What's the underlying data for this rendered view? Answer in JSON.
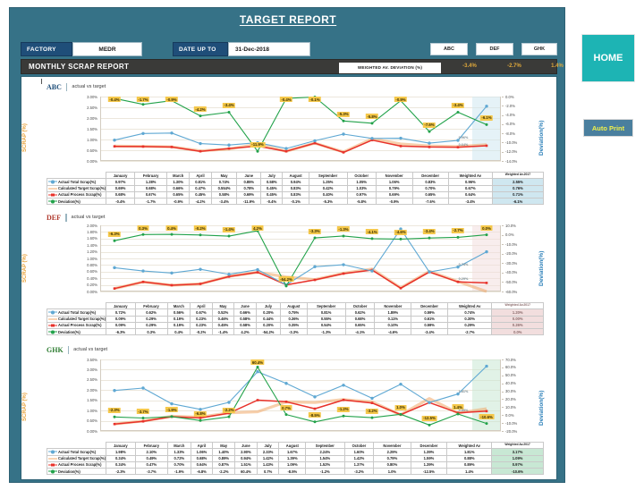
{
  "header": {
    "title": "TARGET REPORT",
    "factory_label": "FACTORY",
    "factory_value": "MEDR",
    "date_label": "DATE UP TO",
    "date_value": "31-Dec-2018",
    "nav": [
      {
        "label": "ABC"
      },
      {
        "label": "DEF"
      },
      {
        "label": "GHK"
      }
    ]
  },
  "band": {
    "title": "MONTHLY SCRAP REPORT",
    "wad_label": "WEIGHTED AV. DEVIATION (%)",
    "wad_values": [
      "-3.4%",
      "-2.7%",
      "1.4%"
    ]
  },
  "side": {
    "home_label": "HOME",
    "autoprint_label": "Auto Print"
  },
  "common": {
    "subtitle": "actual vs target",
    "ylabel_left": "SCRAP (%)",
    "ylabel_right": "Deviation(%)",
    "months": [
      "January",
      "February",
      "March",
      "April",
      "May",
      "June",
      "July",
      "August",
      "September",
      "October",
      "November",
      "December"
    ],
    "col_weighted": "Weighted Av",
    "col_weighted_2017": "Weighted Av.2017",
    "series_names": [
      "Actual Total Scrap(%)",
      "Calculated Target Scrap(%)",
      "Actual Process Scrap(%)",
      "Deviation(%)"
    ],
    "colors": {
      "total": "#5fa8d3",
      "target": "#f0a868",
      "process": "#e8312a",
      "deviation": "#22a24a",
      "label_bg": "#f5c84b",
      "accent_teal": "#1db4b4",
      "header_blue": "#367287",
      "band_dark": "#3a3a38",
      "wad_gold": "#e0a93b"
    }
  },
  "chart_data": [
    {
      "type": "line",
      "id": "ABC",
      "code": "ABC",
      "code_color": "#1f4e79",
      "title": "ABC actual vs target",
      "xlabel": "",
      "ylabel": "SCRAP (%)",
      "ylabel_right": "Deviation(%)",
      "categories": [
        "January",
        "February",
        "March",
        "April",
        "May",
        "June",
        "July",
        "August",
        "September",
        "October",
        "November",
        "December",
        "Weighted Av",
        "Weighted Av.2017"
      ],
      "ylim": [
        0,
        3.0
      ],
      "yticks": [
        "0.00%",
        "0.50%",
        "1.00%",
        "1.50%",
        "2.00%",
        "2.50%",
        "3.00%"
      ],
      "ylim_right": [
        -14.0,
        0.0
      ],
      "yticks_right": [
        "0.0%",
        "-2.0%",
        "-4.0%",
        "-6.0%",
        "-8.0%",
        "-10.0%",
        "-12.0%",
        "-14.0%"
      ],
      "grid": true,
      "highlight_column": "Weighted Av.2017",
      "series": [
        {
          "name": "Actual Total Scrap(%)",
          "color": "#5fa8d3",
          "axis": "left",
          "values": [
            0.97,
            1.28,
            1.3,
            0.81,
            0.74,
            0.85,
            0.58,
            0.94,
            1.25,
            1.05,
            1.06,
            0.83,
            0.96,
            2.55
          ]
        },
        {
          "name": "Calculated Target Scrap(%)",
          "color": "#f0a868",
          "axis": "left",
          "values": [
            0.69,
            0.68,
            0.66,
            0.47,
            0.554,
            0.78,
            0.45,
            0.83,
            0.42,
            1.03,
            0.79,
            0.7,
            0.67,
            0.76
          ]
        },
        {
          "name": "Actual Process Scrap(%)",
          "color": "#e8312a",
          "axis": "left",
          "values": [
            0.68,
            0.67,
            0.65,
            0.45,
            0.58,
            0.69,
            0.45,
            0.83,
            0.4,
            0.97,
            0.69,
            0.65,
            0.64,
            0.71
          ]
        },
        {
          "name": "Deviation(%)",
          "color": "#22a24a",
          "axis": "right",
          "values": [
            -0.4,
            -1.7,
            -0.9,
            -4.2,
            -3.4,
            -11.9,
            -0.4,
            -0.1,
            -5.3,
            -5.8,
            -0.9,
            -7.6,
            -3.4,
            -6.1
          ]
        }
      ],
      "data_labels": [
        "-0.4%",
        "-1.7%",
        "-0.9%",
        "-4.2%",
        "-3.4%",
        "-11.9%",
        "-0.4%",
        "-0.1%",
        "-5.3%",
        "-5.8%",
        "-0.9%",
        "-7.6%",
        "-3.4%",
        "-6.1%"
      ],
      "extra_labels": [
        {
          "text": "0.96%",
          "after_index": 12
        },
        {
          "text": "0.64%",
          "after_index": 12
        }
      ],
      "table": {
        "columns": [
          "January",
          "February",
          "March",
          "April",
          "May",
          "June",
          "July",
          "August",
          "September",
          "October",
          "November",
          "December",
          "Weighted Av",
          "Weighted Av.2017"
        ],
        "rows": [
          {
            "name": "Actual Total Scrap(%)",
            "values": [
              "0.97%",
              "1.28%",
              "1.30%",
              "0.81%",
              "0.74%",
              "0.85%",
              "0.58%",
              "0.94%",
              "1.25%",
              "1.05%",
              "1.06%",
              "0.83%",
              "0.96%",
              "2.55%"
            ]
          },
          {
            "name": "Calculated Target Scrap(%)",
            "values": [
              "0.69%",
              "0.68%",
              "0.66%",
              "0.47%",
              "0.554%",
              "0.78%",
              "0.45%",
              "0.83%",
              "0.42%",
              "1.03%",
              "0.79%",
              "0.70%",
              "0.67%",
              "0.76%"
            ]
          },
          {
            "name": "Actual Process Scrap(%)",
            "values": [
              "0.68%",
              "0.67%",
              "0.65%",
              "0.45%",
              "0.58%",
              "0.69%",
              "0.45%",
              "0.83%",
              "0.40%",
              "0.97%",
              "0.69%",
              "0.65%",
              "0.64%",
              "0.71%"
            ]
          },
          {
            "name": "Deviation(%)",
            "values": [
              "-0.4%",
              "-1.7%",
              "-0.9%",
              "-4.2%",
              "-3.4%",
              "-11.9%",
              "-0.4%",
              "-0.1%",
              "-5.3%",
              "-5.8%",
              "-0.9%",
              "-7.6%",
              "-3.4%",
              "-6.1%"
            ]
          }
        ]
      }
    },
    {
      "type": "line",
      "id": "DEF",
      "code": "DEF",
      "code_color": "#b03a2e",
      "title": "DEF actual vs target",
      "xlabel": "",
      "ylabel": "SCRAP (%)",
      "ylabel_right": "Deviation(%)",
      "categories": [
        "January",
        "February",
        "March",
        "April",
        "May",
        "June",
        "July",
        "August",
        "September",
        "October",
        "November",
        "December",
        "Weighted Av",
        "Weighted Av.2017"
      ],
      "ylim": [
        0,
        2.0
      ],
      "yticks": [
        "0.00%",
        "0.20%",
        "0.40%",
        "0.60%",
        "0.80%",
        "1.00%",
        "1.20%",
        "1.40%",
        "1.60%",
        "1.80%",
        "2.00%"
      ],
      "ylim_right": [
        -60.0,
        10.0
      ],
      "yticks_right": [
        "10.0%",
        "0.0%",
        "-10.0%",
        "-20.0%",
        "-30.0%",
        "-40.0%",
        "-50.0%",
        "-60.0%"
      ],
      "grid": true,
      "highlight_column": "Weighted Av.2017",
      "series": [
        {
          "name": "Actual Total Scrap(%)",
          "color": "#5fa8d3",
          "axis": "left",
          "values": [
            0.72,
            0.62,
            0.56,
            0.67,
            0.52,
            0.66,
            0.2,
            0.75,
            0.81,
            0.62,
            1.89,
            0.59,
            0.74,
            1.2
          ]
        },
        {
          "name": "Calculated Target Scrap(%)",
          "color": "#f0a868",
          "axis": "left",
          "values": [
            0.09,
            0.29,
            0.19,
            0.23,
            0.46,
            0.58,
            0.44,
            0.36,
            0.55,
            0.68,
            0.11,
            0.61,
            0.3,
            0.0
          ]
        },
        {
          "name": "Actual Process Scrap(%)",
          "color": "#e8312a",
          "axis": "left",
          "values": [
            0.09,
            0.29,
            0.19,
            0.23,
            0.45,
            0.58,
            0.2,
            0.35,
            0.54,
            0.65,
            0.1,
            0.59,
            0.29,
            0.26
          ]
        },
        {
          "name": "Deviation(%)",
          "color": "#22a24a",
          "axis": "right",
          "values": [
            -6.3,
            0.3,
            0.4,
            -0.2,
            -1.4,
            4.2,
            -54.2,
            -3.3,
            -1.3,
            -4.1,
            -4.6,
            -3.4,
            -2.7,
            0.0
          ]
        }
      ],
      "data_labels": [
        "-6.3%",
        "0.3%",
        "0.4%",
        "-0.2%",
        "-1.4%",
        "4.2%",
        "-54.2%",
        "-3.3%",
        "-1.3%",
        "-4.1%",
        "-4.6%",
        "-3.4%",
        "-2.7%",
        "0.0%"
      ],
      "extra_labels": [
        {
          "text": "0.74%",
          "after_index": 12
        },
        {
          "text": "0.29%",
          "after_index": 12
        }
      ],
      "table": {
        "columns": [
          "January",
          "February",
          "March",
          "April",
          "May",
          "June",
          "July",
          "August",
          "September",
          "October",
          "November",
          "December",
          "Weighted Av",
          "Weighted Av.2017"
        ],
        "rows": [
          {
            "name": "Actual Total Scrap(%)",
            "values": [
              "0.72%",
              "0.62%",
              "0.56%",
              "0.67%",
              "0.52%",
              "0.66%",
              "0.20%",
              "0.75%",
              "0.81%",
              "0.62%",
              "1.89%",
              "0.59%",
              "0.74%",
              "1.20%"
            ]
          },
          {
            "name": "Calculated Target Scrap(%)",
            "values": [
              "0.09%",
              "0.29%",
              "0.19%",
              "0.23%",
              "0.46%",
              "0.58%",
              "0.44%",
              "0.36%",
              "0.55%",
              "0.68%",
              "0.11%",
              "0.61%",
              "0.30%",
              "0.00%"
            ]
          },
          {
            "name": "Actual Process Scrap(%)",
            "values": [
              "0.09%",
              "0.29%",
              "0.19%",
              "0.23%",
              "0.45%",
              "0.58%",
              "0.20%",
              "0.35%",
              "0.54%",
              "0.65%",
              "0.10%",
              "0.59%",
              "0.29%",
              "0.26%"
            ]
          },
          {
            "name": "Deviation(%)",
            "values": [
              "-6.3%",
              "0.3%",
              "0.4%",
              "-0.2%",
              "-1.4%",
              "4.2%",
              "-54.2%",
              "-3.3%",
              "-1.3%",
              "-4.1%",
              "-4.6%",
              "-3.4%",
              "-2.7%",
              "0.0%"
            ]
          }
        ]
      }
    },
    {
      "type": "line",
      "id": "GHK",
      "code": "GHK",
      "code_color": "#2e7d32",
      "title": "GHK actual vs target",
      "xlabel": "",
      "ylabel": "SCRAP (%)",
      "ylabel_right": "Deviation(%)",
      "categories": [
        "January",
        "February",
        "March",
        "April",
        "May",
        "June",
        "July",
        "August",
        "September",
        "October",
        "November",
        "December",
        "Weighted Av",
        "Weighted Av.2017"
      ],
      "ylim": [
        0,
        3.5
      ],
      "yticks": [
        "0.00%",
        "0.50%",
        "1.00%",
        "1.50%",
        "2.00%",
        "2.50%",
        "3.00%",
        "3.50%"
      ],
      "ylim_right": [
        -20.0,
        70.0
      ],
      "yticks_right": [
        "70.0%",
        "60.0%",
        "50.0%",
        "40.0%",
        "30.0%",
        "20.0%",
        "10.0%",
        "0.0%",
        "-10.0%",
        "-20.0%"
      ],
      "grid": true,
      "highlight_column": "Weighted Av.2017",
      "series": [
        {
          "name": "Actual Total Scrap(%)",
          "color": "#5fa8d3",
          "axis": "left",
          "values": [
            1.98,
            2.1,
            1.33,
            1.06,
            1.4,
            2.9,
            2.33,
            1.67,
            2.24,
            1.6,
            2.29,
            1.39,
            1.81,
            3.17
          ]
        },
        {
          "name": "Calculated Target Scrap(%)",
          "color": "#f0a868",
          "axis": "left",
          "values": [
            0.34,
            0.49,
            0.72,
            0.68,
            0.89,
            0.94,
            1.42,
            1.39,
            1.54,
            1.42,
            0.79,
            1.59,
            0.88,
            1.09
          ]
        },
        {
          "name": "Actual Process Scrap(%)",
          "color": "#e8312a",
          "axis": "left",
          "values": [
            0.34,
            0.47,
            0.7,
            0.64,
            0.87,
            1.51,
            1.43,
            1.09,
            1.52,
            1.37,
            0.8,
            1.39,
            0.89,
            0.97
          ]
        },
        {
          "name": "Deviation(%)",
          "color": "#22a24a",
          "axis": "right",
          "values": [
            -2.3,
            -3.7,
            -1.9,
            -6.8,
            -2.2,
            60.4,
            0.7,
            -8.5,
            -1.2,
            -3.2,
            1.0,
            -12.5,
            1.4,
            -10.6
          ]
        }
      ],
      "data_labels": [
        "-2.3%",
        "-3.7%",
        "-1.9%",
        "-6.8%",
        "-2.2%",
        "60.4%",
        "0.7%",
        "-8.5%",
        "-1.2%",
        "-3.2%",
        "1.0%",
        "-12.5%",
        "1.4%",
        "-10.6%"
      ],
      "extra_labels": [
        {
          "text": "1.81%",
          "after_index": 12
        },
        {
          "text": "0.89%",
          "after_index": 12
        }
      ],
      "table": {
        "columns": [
          "January",
          "February",
          "March",
          "April",
          "May",
          "June",
          "July",
          "August",
          "September",
          "October",
          "November",
          "December",
          "Weighted Av",
          "Weighted Av.2017"
        ],
        "rows": [
          {
            "name": "Actual Total Scrap(%)",
            "values": [
              "1.98%",
              "2.10%",
              "1.33%",
              "1.06%",
              "1.40%",
              "2.90%",
              "2.33%",
              "1.67%",
              "2.24%",
              "1.60%",
              "2.29%",
              "1.39%",
              "1.81%",
              "3.17%"
            ]
          },
          {
            "name": "Calculated Target Scrap(%)",
            "values": [
              "0.34%",
              "0.49%",
              "0.72%",
              "0.68%",
              "0.89%",
              "0.94%",
              "1.42%",
              "1.39%",
              "1.54%",
              "1.42%",
              "0.79%",
              "1.59%",
              "0.88%",
              "1.09%"
            ]
          },
          {
            "name": "Actual Process Scrap(%)",
            "values": [
              "0.34%",
              "0.47%",
              "0.70%",
              "0.64%",
              "0.87%",
              "1.51%",
              "1.43%",
              "1.09%",
              "1.52%",
              "1.37%",
              "0.80%",
              "1.39%",
              "0.89%",
              "0.97%"
            ]
          },
          {
            "name": "Deviation(%)",
            "values": [
              "-2.3%",
              "-3.7%",
              "-1.9%",
              "-6.8%",
              "-2.2%",
              "60.4%",
              "0.7%",
              "-8.5%",
              "-1.2%",
              "-3.2%",
              "1.0%",
              "-12.5%",
              "1.4%",
              "-10.6%"
            ]
          }
        ]
      }
    }
  ]
}
